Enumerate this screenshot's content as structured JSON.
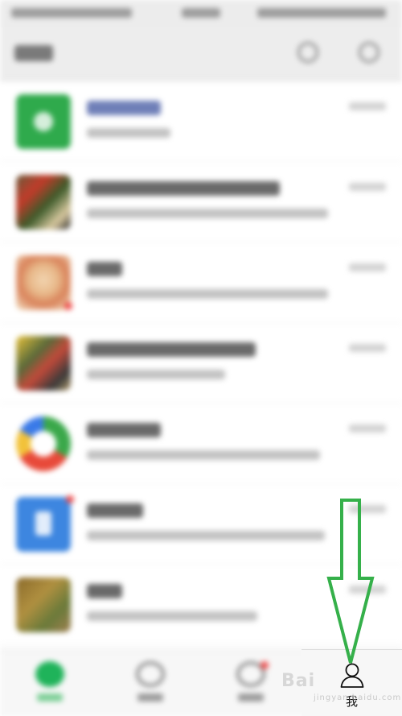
{
  "tab_bar": {
    "me_label": "我",
    "me_icon": "person-outline-icon"
  },
  "annotation": {
    "arrow_color": "#35b04a",
    "arrow_direction": "down"
  },
  "watermark": {
    "text": "Bai",
    "subtext": "jingyan.baidu.com"
  },
  "colors": {
    "accent_green": "#07c160",
    "badge_red": "#ef4b4b"
  }
}
